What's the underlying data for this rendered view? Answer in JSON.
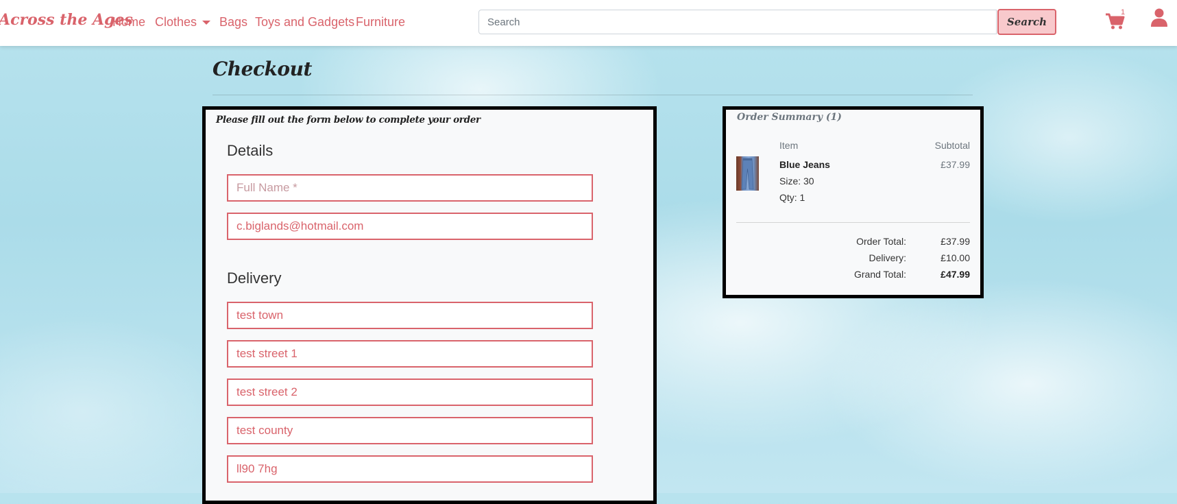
{
  "nav": {
    "brand": "Across the Ages",
    "links": [
      "Home",
      "Clothes",
      "Bags",
      "Toys and Gadgets",
      "Furniture"
    ],
    "search_placeholder": "Search",
    "search_button": "Search",
    "cart_count": "1"
  },
  "page": {
    "title": "Checkout"
  },
  "form": {
    "intro": "Please fill out the form below to complete your order",
    "details_label": "Details",
    "full_name_placeholder": "Full Name *",
    "email_value": "c.biglands@hotmail.com",
    "delivery_label": "Delivery",
    "town_value": "test town",
    "street1_value": "test street 1",
    "street2_value": "test street 2",
    "county_value": "test county",
    "postcode_value": "ll90 7hg"
  },
  "summary": {
    "title": "Order Summary (1)",
    "item_header": "Item",
    "subtotal_header": "Subtotal",
    "product": {
      "name": "Blue Jeans",
      "size": "Size: 30",
      "qty": "Qty: 1",
      "price": "£37.99"
    },
    "order_total_label": "Order Total:",
    "order_total": "£37.99",
    "delivery_label": "Delivery:",
    "delivery": "£10.00",
    "grand_total_label": "Grand Total:",
    "grand_total": "£47.99"
  },
  "colors": {
    "accent": "#d9636b",
    "button_bg": "#f8c9cc"
  },
  "icons": {
    "cart": "shopping-cart-icon",
    "user": "user-icon",
    "dropdown": "caret-down-icon"
  }
}
